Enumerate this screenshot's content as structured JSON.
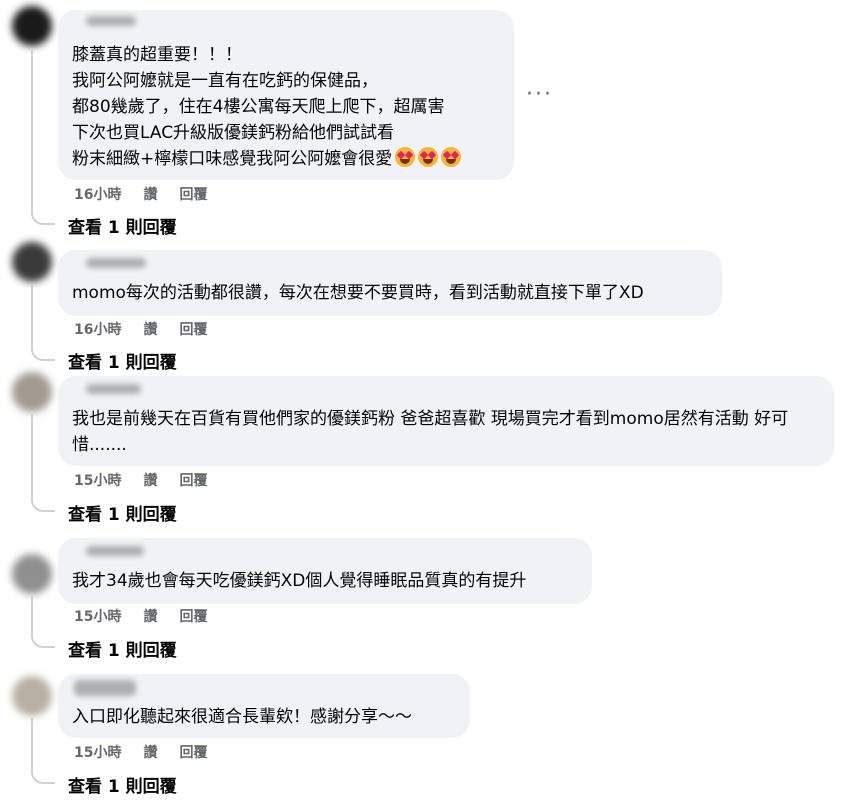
{
  "comments": [
    {
      "text": "膝蓋真的超重要！！！\n我阿公阿嬤就是一直有在吃鈣的保健品，\n都80幾歲了，住在4樓公寓每天爬上爬下，超厲害\n下次也買LAC升級版優鎂鈣粉給他們試試看\n粉末細緻+檸檬口味感覺我阿公阿嬤會很愛",
      "emojis": [
        "heart-eyes-emoji",
        "heart-eyes-emoji",
        "heart-eyes-emoji"
      ],
      "time": "16小時",
      "like": "讚",
      "reply": "回覆",
      "view_replies": "查看 1 則回覆",
      "more": "···"
    },
    {
      "text": "momo每次的活動都很讚，每次在想要不要買時，看到活動就直接下單了XD",
      "time": "16小時",
      "like": "讚",
      "reply": "回覆",
      "view_replies": "查看 1 則回覆"
    },
    {
      "text": "我也是前幾天在百貨有買他們家的優鎂鈣粉 爸爸超喜歡 現場買完才看到momo居然有活動 好可惜.......",
      "time": "15小時",
      "like": "讚",
      "reply": "回覆",
      "view_replies": "查看 1 則回覆"
    },
    {
      "text": "我才34歲也會每天吃優鎂鈣XD個人覺得睡眠品質真的有提升",
      "time": "15小時",
      "like": "讚",
      "reply": "回覆",
      "view_replies": "查看 1 則回覆"
    },
    {
      "text": "入口即化聽起來很適合長輩欸！感謝分享～～",
      "time": "15小時",
      "like": "讚",
      "reply": "回覆",
      "view_replies": "查看 1 則回覆"
    }
  ]
}
